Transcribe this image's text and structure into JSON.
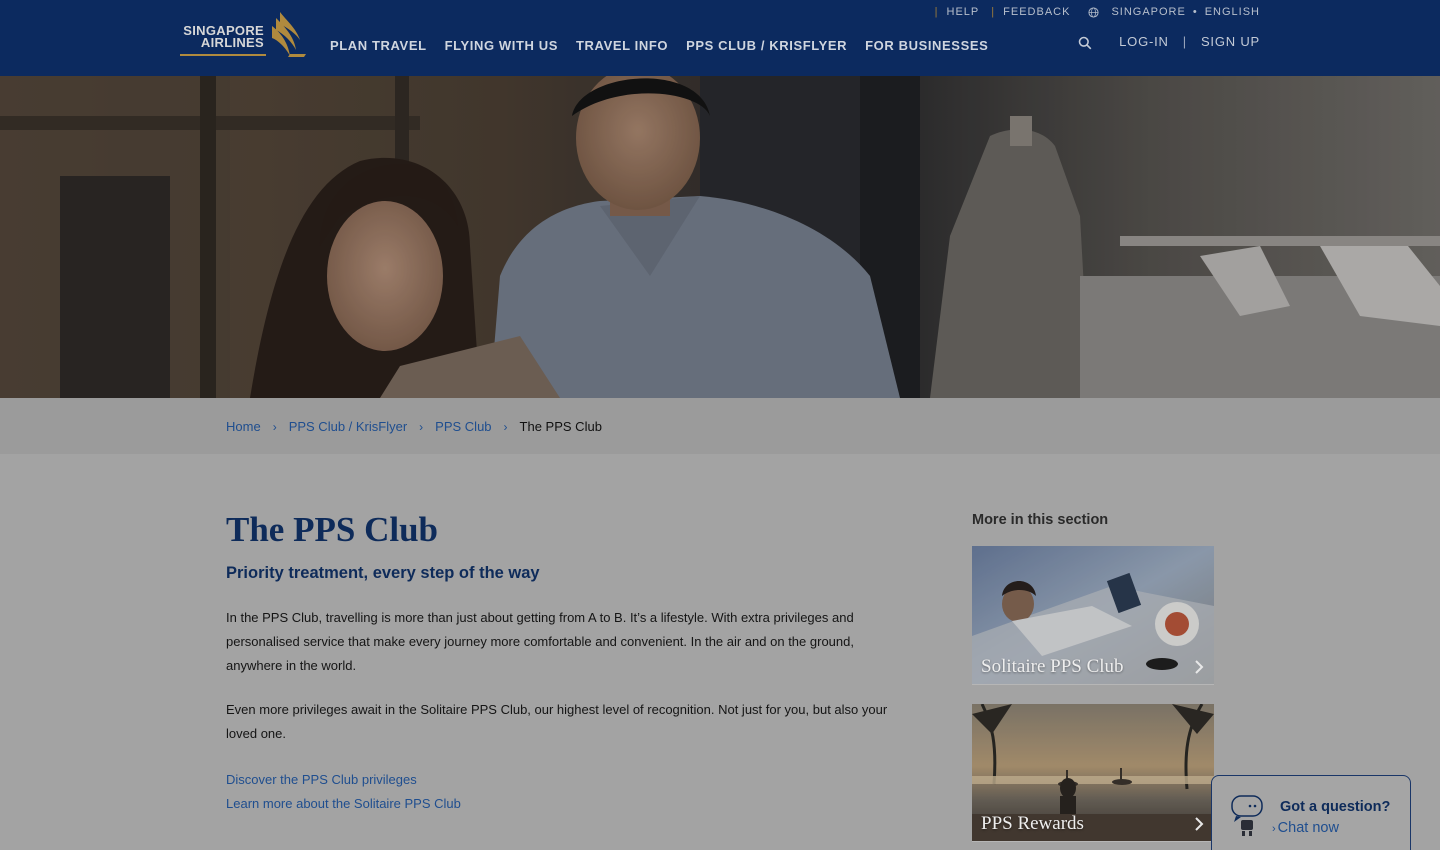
{
  "header": {
    "logo": {
      "line1": "SINGAPORE",
      "line2": "AIRLINES"
    },
    "nav": [
      {
        "label": "PLAN TRAVEL"
      },
      {
        "label": "FLYING WITH US"
      },
      {
        "label": "TRAVEL INFO"
      },
      {
        "label": "PPS CLUB / KRISFLYER"
      },
      {
        "label": "FOR BUSINESSES"
      }
    ],
    "topbar": {
      "help": "HELP",
      "feedback": "FEEDBACK",
      "country": "SINGAPORE",
      "language": "ENGLISH"
    },
    "account": {
      "login": "LOG-IN",
      "signup": "SIGN UP"
    }
  },
  "breadcrumb": {
    "items": [
      {
        "label": "Home"
      },
      {
        "label": "PPS Club / KrisFlyer"
      },
      {
        "label": "PPS Club"
      }
    ],
    "current": "The PPS Club"
  },
  "main": {
    "title": "The PPS Club",
    "subtitle": "Priority treatment, every step of the way",
    "paragraphs": [
      "In the PPS Club, travelling is more than just about getting from A to B. It’s a lifestyle. With extra privileges and personalised service that make every journey more comfortable and convenient. In the air and on the ground, anywhere in the world.",
      "Even more privileges await in the Solitaire PPS Club, our highest level of recognition. Not just for you, but also your loved one."
    ],
    "links": [
      {
        "label": "Discover the PPS Club privileges"
      },
      {
        "label": "Learn more about the Solitaire PPS Club"
      }
    ]
  },
  "sidebar": {
    "title": "More in this section",
    "cards": [
      {
        "label": "Solitaire PPS Club"
      },
      {
        "label": "PPS Rewards"
      }
    ]
  },
  "chat": {
    "question": "Got a question?",
    "action": "Chat now"
  },
  "colors": {
    "header_bg": "#0c2a5f",
    "brand_gold": "#b08a3e",
    "link_blue": "#1f4e8f",
    "heading_navy": "#0e2b5a"
  },
  "icons": [
    "singapore-airlines-bird-logo",
    "globe-icon",
    "search-icon",
    "chevron-right-icon",
    "chatbot-icon"
  ]
}
